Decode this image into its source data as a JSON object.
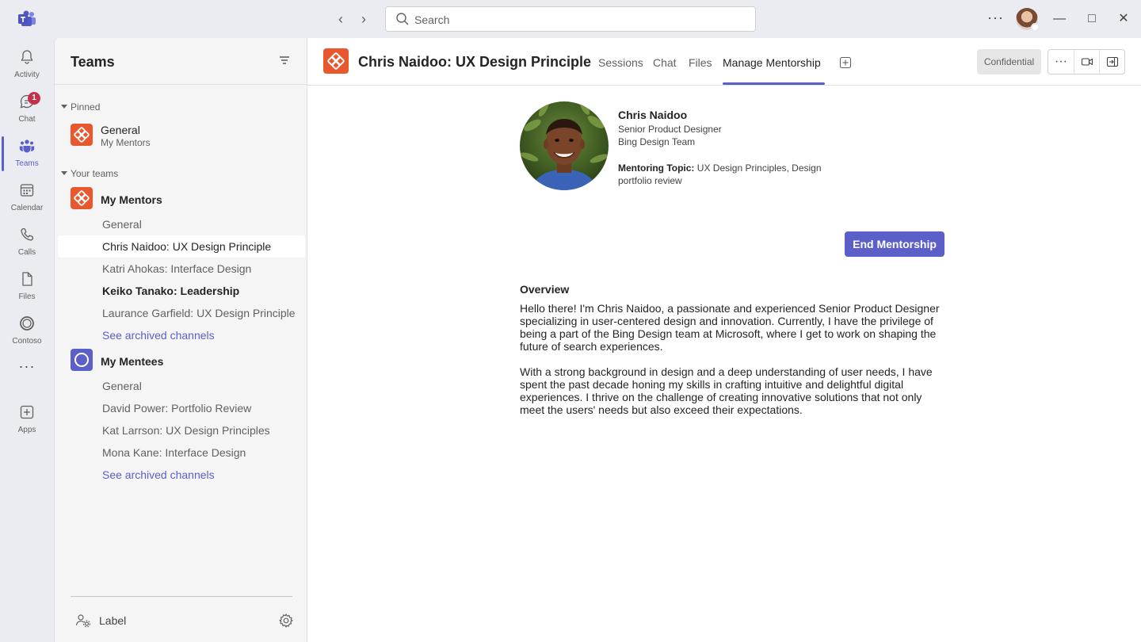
{
  "titlebar": {
    "search_placeholder": "Search",
    "more_icon": "more-horizontal-icon"
  },
  "rail": {
    "items": [
      {
        "label": "Activity",
        "icon": "bell-icon"
      },
      {
        "label": "Chat",
        "icon": "chat-icon",
        "badge": "1"
      },
      {
        "label": "Teams",
        "icon": "teams-icon",
        "active": true
      },
      {
        "label": "Calendar",
        "icon": "calendar-icon"
      },
      {
        "label": "Calls",
        "icon": "phone-icon"
      },
      {
        "label": "Files",
        "icon": "file-icon"
      },
      {
        "label": "Contoso",
        "icon": "contoso-icon"
      },
      {
        "label": "Apps",
        "icon": "apps-add-icon"
      }
    ]
  },
  "panel": {
    "title": "Teams",
    "pinned_header": "Pinned",
    "pinned": {
      "name": "General",
      "team": "My Mentors"
    },
    "your_teams_header": "Your teams",
    "teams": [
      {
        "name": "My Mentors",
        "channels": [
          "General",
          "Chris Naidoo: UX Design Principle",
          "Katri Ahokas: Interface Design",
          "Keiko Tanako: Leadership",
          "Laurance Garfield: UX Design Principle"
        ],
        "archived": "See archived channels"
      },
      {
        "name": "My Mentees",
        "channels": [
          "General",
          "David Power: Portfolio Review",
          "Kat Larrson: UX Design Principles",
          "Mona Kane: Interface Design"
        ],
        "archived": "See archived channels"
      }
    ],
    "footer_label": "Label"
  },
  "main": {
    "channel_title": "Chris Naidoo: UX Design Principle",
    "tabs": [
      "Sessions",
      "Chat",
      "Files",
      "Manage Mentorship"
    ],
    "active_tab": "Manage Mentorship",
    "sensitivity": "Confidential",
    "profile": {
      "name": "Chris Naidoo",
      "role": "Senior Product Designer",
      "team": "Bing Design Team",
      "topic_label": "Mentoring Topic:",
      "topic_value": "UX Design Principles, Design portfolio review"
    },
    "end_button": "End Mentorship",
    "overview_heading": "Overview",
    "overview_paragraphs": [
      "Hello there! I'm Chris Naidoo, a passionate and experienced Senior Product Designer specializing in user-centered design and innovation. Currently, I have the privilege of being a part of the Bing Design team at Microsoft, where I get to work on shaping the future of search experiences.",
      "With a strong background in design and a deep understanding of user needs, I have spent the past decade honing my skills in crafting intuitive and delightful digital experiences. I thrive on the challenge of creating innovative solutions that not only meet the users' needs but also exceed their expectations."
    ]
  },
  "colors": {
    "brand": "#5b5fc7",
    "team_orange": "#e8572e",
    "badge_red": "#c4314b"
  }
}
